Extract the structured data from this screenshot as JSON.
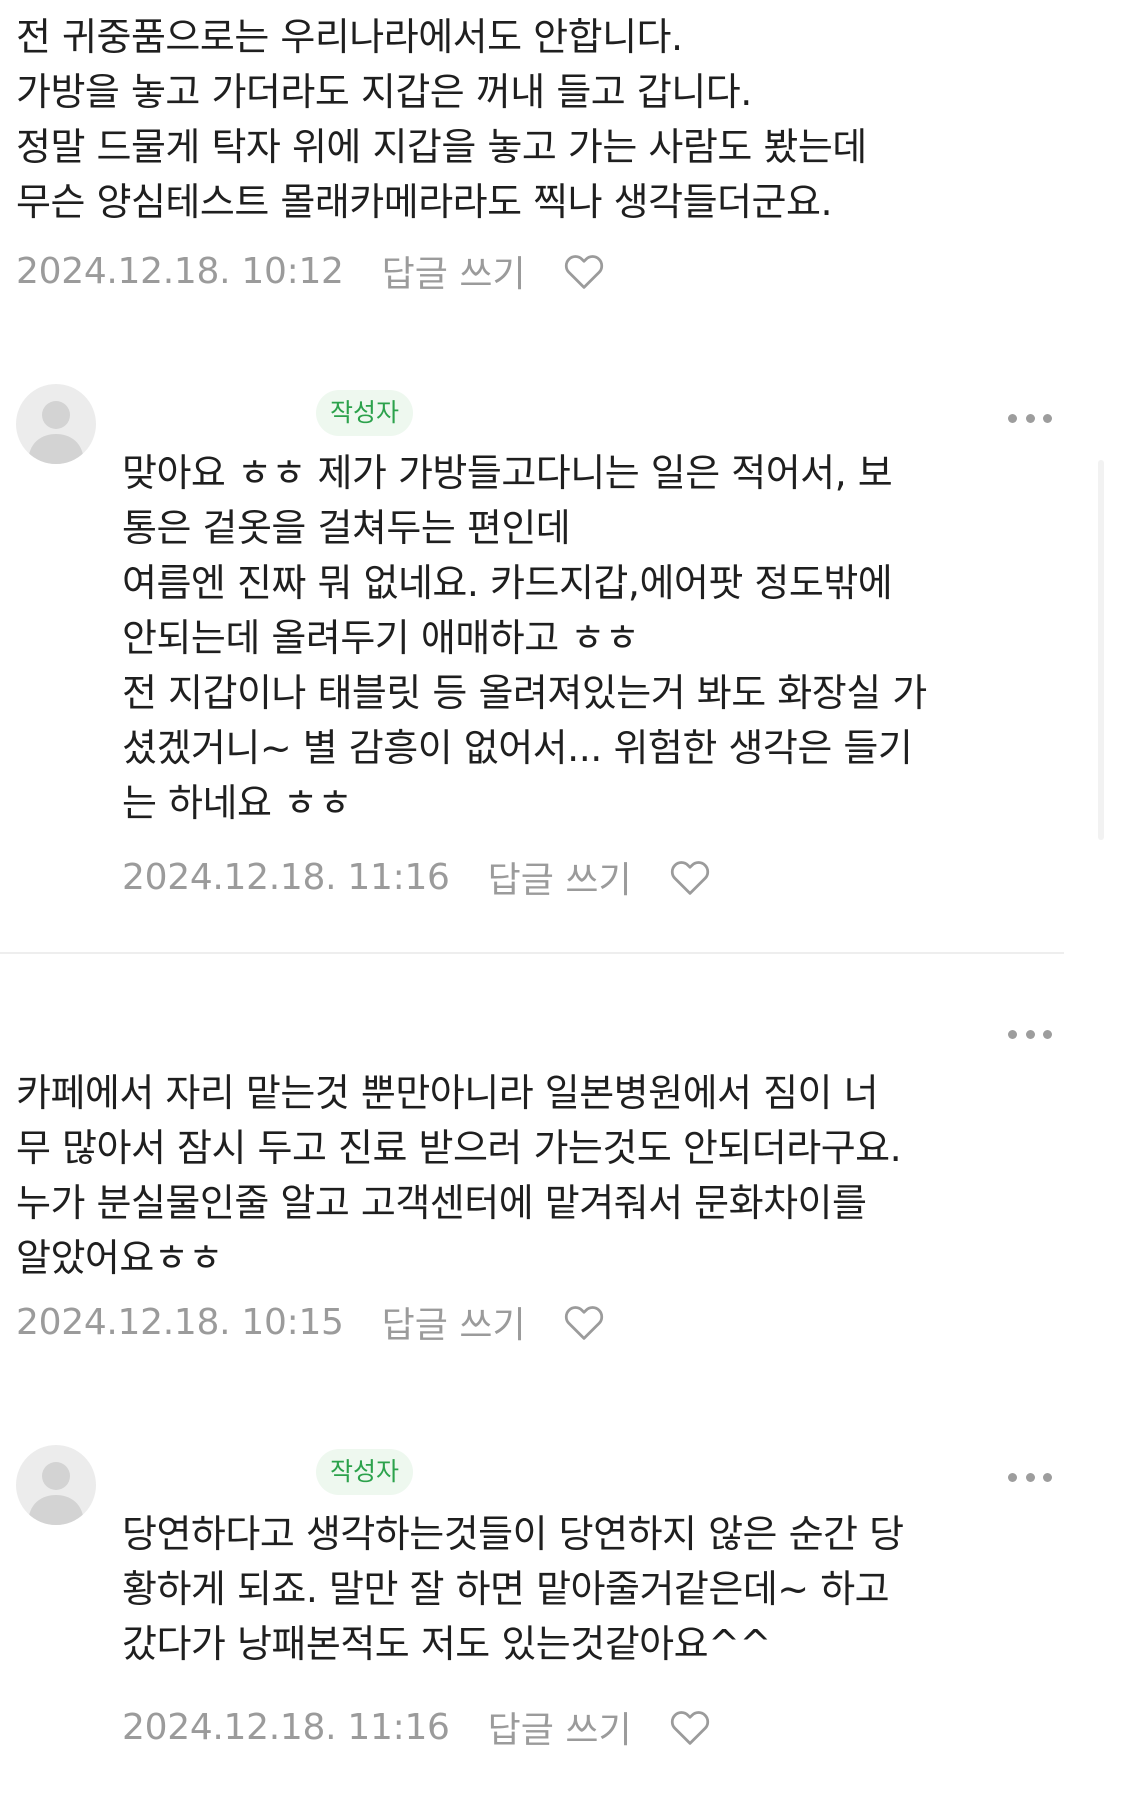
{
  "comments": [
    {
      "text": "전 귀중품으로는 우리나라에서도 안합니다.\n가방을 놓고 가더라도 지갑은 꺼내 들고 갑니다.\n정말 드물게 탁자 위에 지갑을 놓고 가는 사람도 봤는데\n무슨 양심테스트 몰래카메라라도 찍나 생각들더군요.",
      "timestamp": "2024.12.18. 10:12",
      "reply_label": "답글 쓰기"
    },
    {
      "badge": "작성자",
      "text": "맞아요 ㅎㅎ 제가 가방들고다니는 일은 적어서, 보\n통은 겉옷을 걸쳐두는 편인데\n여름엔 진짜 뭐 없네요. 카드지갑,에어팟 정도밖에\n안되는데 올려두기 애매하고 ㅎㅎ\n전 지갑이나 태블릿 등 올려져있는거 봐도 화장실 가\n셨겠거니~ 별 감흥이 없어서... 위험한 생각은 들기\n는 하네요 ㅎㅎ",
      "timestamp": "2024.12.18. 11:16",
      "reply_label": "답글 쓰기"
    },
    {
      "text": "카페에서 자리 맡는것 뿐만아니라 일본병원에서 짐이 너\n무 많아서 잠시 두고 진료 받으러 가는것도 안되더라구요.\n누가 분실물인줄 알고 고객센터에 맡겨줘서 문화차이를\n알았어요ㅎㅎ",
      "timestamp": "2024.12.18. 10:15",
      "reply_label": "답글 쓰기"
    },
    {
      "badge": "작성자",
      "text": "당연하다고 생각하는것들이 당연하지 않은 순간 당\n황하게 되죠. 말만 잘 하면 맡아줄거같은데~ 하고\n갔다가 낭패본적도 저도 있는것같아요^^",
      "timestamp": "2024.12.18. 11:16",
      "reply_label": "답글 쓰기"
    }
  ],
  "icons": {
    "like": "heart-outline-icon",
    "more": "more-horizontal-icon",
    "avatar": "default-user-avatar-icon"
  },
  "colors": {
    "badge_text": "#2ca24c",
    "badge_bg": "#eef8ef",
    "meta_text": "#9b9b9b",
    "body_text": "#1f1f1f"
  }
}
